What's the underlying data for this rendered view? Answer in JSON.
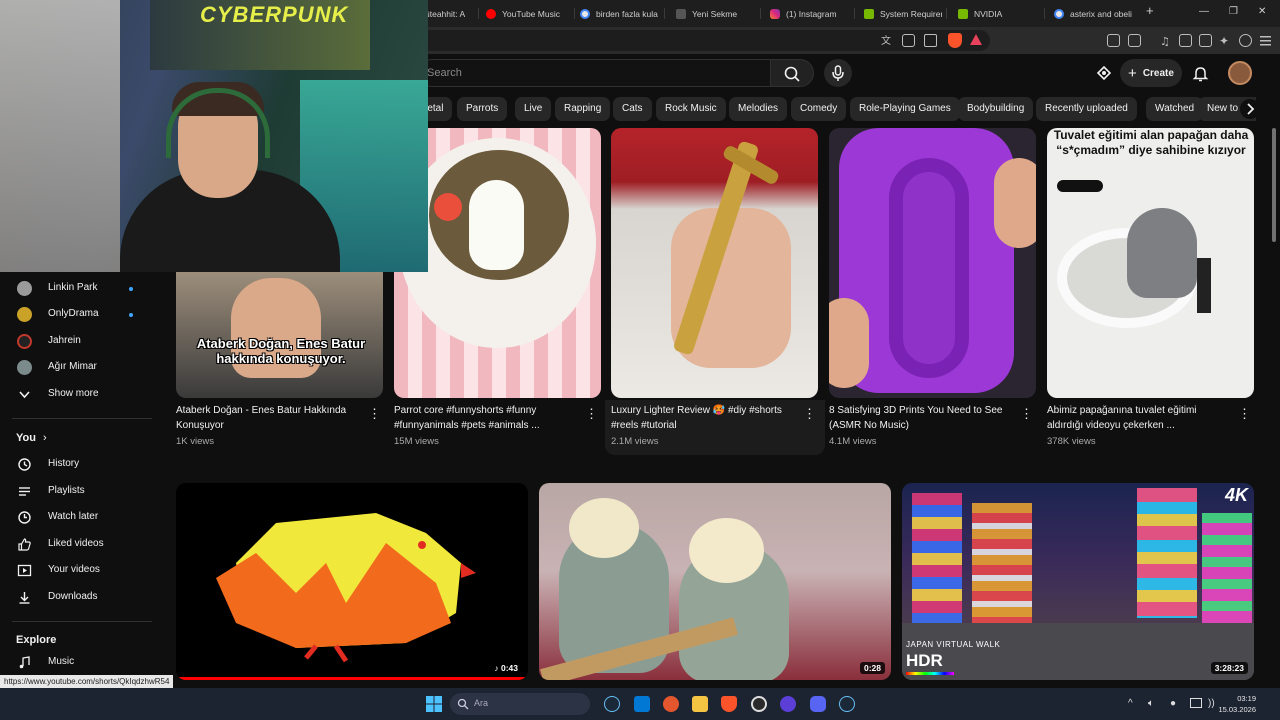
{
  "browser": {
    "tabs": [
      {
        "label": "üteahhit: A",
        "color": "#1a73e8"
      },
      {
        "label": "YouTube Music",
        "color": "#ff0000"
      },
      {
        "label": "birden fazla kula",
        "color": "#4285f4"
      },
      {
        "label": "Yeni Sekme",
        "color": "#9aa0a6"
      },
      {
        "label": "(1) Instagram",
        "color": "#e1306c"
      },
      {
        "label": "System Requirem",
        "color": "#76b900"
      },
      {
        "label": "NVIDIA",
        "color": "#76b900"
      },
      {
        "label": "asterix and obeli",
        "color": "#4285f4"
      }
    ],
    "new_tab": "+",
    "min": "—",
    "restore": "❐",
    "close": "✕"
  },
  "header": {
    "search_placeholder": "Search",
    "create_label": "Create"
  },
  "chips": [
    "Metal",
    "Parrots",
    "Live",
    "Rapping",
    "Cats",
    "Rock Music",
    "Melodies",
    "Comedy",
    "Role-Playing Games",
    "Bodybuilding",
    "Recently uploaded",
    "Watched",
    "New to you"
  ],
  "sidebar": {
    "subscriptions": [
      {
        "label": "Linkin Park",
        "dot": true,
        "color": "#9a9a9a"
      },
      {
        "label": "OnlyDrama",
        "dot": true,
        "color": "#c9a227"
      },
      {
        "label": "Jahrein",
        "dot": false,
        "color": "#c0392b"
      },
      {
        "label": "Ağır Mimar",
        "dot": false,
        "color": "#7b8a8b"
      }
    ],
    "show_more": "Show more",
    "you_header": "You",
    "you_items": [
      "History",
      "Playlists",
      "Watch later",
      "Liked videos",
      "Your videos",
      "Downloads"
    ],
    "explore_header": "Explore",
    "explore_items": [
      "Music"
    ]
  },
  "shorts": [
    {
      "title": "Ataberk Doğan - Enes Batur Hakkında Konuşuyor",
      "views": "1K views",
      "overlay": "Ataberk Doğan, Enes Batur hakkında konuşuyor."
    },
    {
      "title": "Parrot core #funnyshorts #funny #funnyanimals #pets #animals ...",
      "views": "15M views"
    },
    {
      "title": "Luxury Lighter Review 🥵 #diy #shorts #reels #tutorial",
      "views": "2.1M views"
    },
    {
      "title": "8 Satisfying 3D Prints You Need to See (ASMR No Music)",
      "views": "4.1M views"
    },
    {
      "title": "Abimiz papağanına tuvalet eğitimi aldırdığı videoyu çekerken ...",
      "views": "378K views",
      "overlay": "Tuvalet eğitimi alan papağan daha “s*çmadım” diye sahibine kızıyor"
    }
  ],
  "videos": [
    {
      "duration": "0:43",
      "shorts_icon": "♪"
    },
    {
      "duration": "0:28"
    },
    {
      "duration": "3:28:23",
      "badge": "4K",
      "label": "HDR",
      "sub": "JAPAN VIRTUAL WALK"
    }
  ],
  "webcam_poster_text": "CYBERPUNK",
  "status_url": "https://www.youtube.com/shorts/QkIqdzhwR54",
  "taskbar": {
    "search_placeholder": "Ara",
    "time": "03:19",
    "date": "15.03.2026"
  }
}
